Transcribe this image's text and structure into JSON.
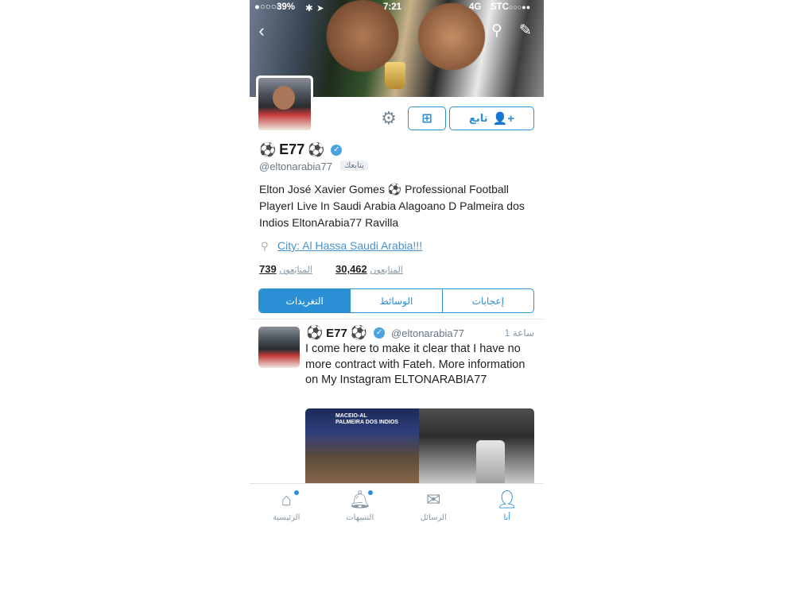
{
  "status_bar": {
    "battery": "39%",
    "time": "7:21",
    "network": "4G",
    "carrier": "STC"
  },
  "profile": {
    "name": "E77",
    "name_emoji_left": "⚽",
    "name_emoji_right": "⚽",
    "handle": "@eltonarabia77",
    "follows_you": "يتابعك",
    "bio": "Elton José Xavier Gomes ⚽ Professional Football PlayerI Live In Saudi Arabia Alagoano D Palmeira dos Indios EltonArabia77 Ravilla",
    "location": "City: Al Hassa Saudi Arabia!!!",
    "following_count": "739",
    "following_label": "المتابَعون",
    "followers_count": "30,462",
    "followers_label": "المتابعون"
  },
  "actions": {
    "follow_label": "تابع",
    "follow_icon": "add-user-icon",
    "lists_icon": "lists-icon",
    "settings_icon": "gear-icon"
  },
  "tabs": [
    {
      "label": "إعجابات"
    },
    {
      "label": "الوسائط"
    },
    {
      "label": "التغريدات",
      "active": true
    }
  ],
  "tweet": {
    "name": "E77",
    "handle": "@eltonarabia77",
    "time": "1 ساعة",
    "text": "I come here to make it clear that I have no more contract with Fateh. More information on My Instagram ELTONARABIA77",
    "media_caption": "MACEIO-AL\nPALMEIRA DOS INDIOS"
  },
  "tabbar": [
    {
      "label": "الرئيسية",
      "icon": "home-icon",
      "dot": true
    },
    {
      "label": "التنبيهات",
      "icon": "bell-icon",
      "dot": true
    },
    {
      "label": "الرسائل",
      "icon": "envelope-icon",
      "dot": false
    },
    {
      "label": "أنا",
      "icon": "person-icon",
      "dot": false,
      "active": true
    }
  ],
  "colors": {
    "accent": "#2b8fd6",
    "muted": "#8899a6"
  }
}
